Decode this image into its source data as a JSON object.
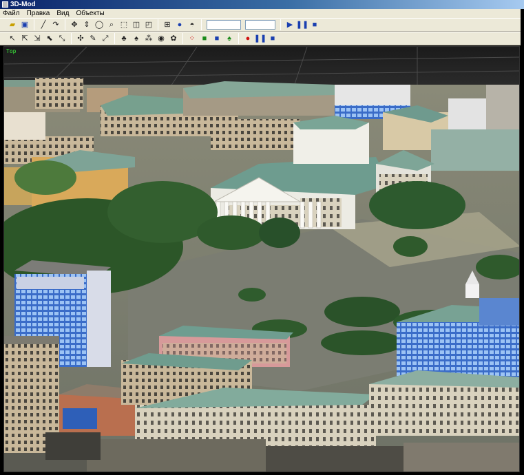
{
  "window": {
    "title": "3D-Mod"
  },
  "menu": {
    "items": [
      "Файл",
      "Правка",
      "Вид",
      "Объекты"
    ]
  },
  "toolbar1": {
    "icons": [
      "open-folder-icon",
      "save-icon",
      "draw-line-icon",
      "curve-icon",
      "move-icon",
      "move-vertical-icon",
      "rotate-icon",
      "zoom-icon",
      "fit-view-icon",
      "cube-front-icon",
      "cube-side-icon",
      "grid-icon",
      "sphere-icon",
      "camera-icon"
    ],
    "field1": "",
    "field2": "",
    "playback": [
      "play-icon",
      "pause-icon",
      "stop-icon"
    ]
  },
  "toolbar2": {
    "icons": [
      "select-icon",
      "select-vertex-icon",
      "select-edge-icon",
      "select-face-icon",
      "transform-icon",
      "edit-icon",
      "pen-icon",
      "scale-icon",
      "tree-icon",
      "tree2-icon",
      "tree3-icon",
      "eye-icon",
      "palette-icon",
      "dots-red-icon",
      "cube-green-icon",
      "cube-blue-icon",
      "leaf-icon"
    ],
    "record": [
      "record-icon",
      "pause-icon",
      "stop-icon"
    ]
  },
  "viewport": {
    "label": "Top"
  },
  "colors": {
    "viewport_label": "#3cf03c",
    "titlebar_start": "#0a246a",
    "ground": "#7c8074",
    "roof": "#6d9a8a"
  }
}
